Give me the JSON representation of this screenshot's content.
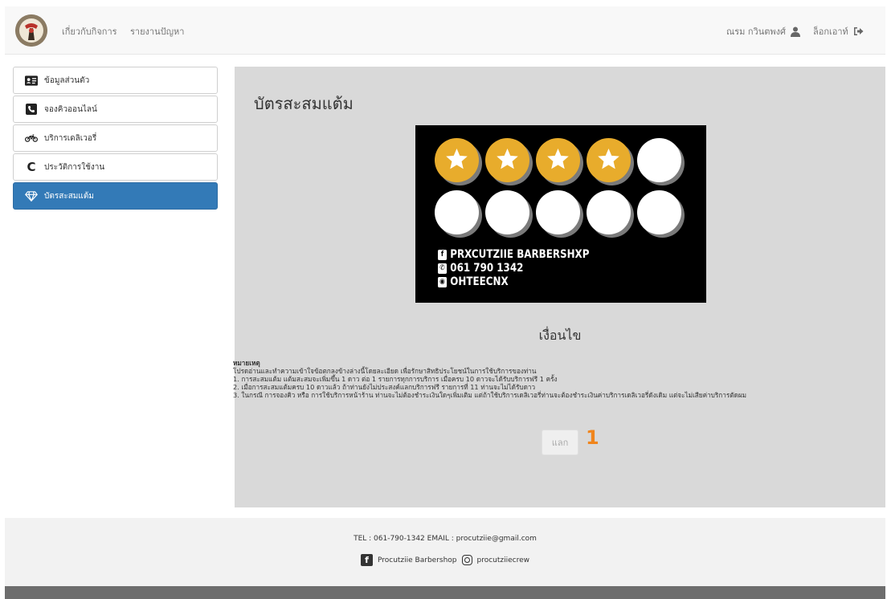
{
  "nav": {
    "links": [
      "เกี่ยวกับกิจการ",
      "รายงานปัญหา"
    ],
    "user_name": "ณรม กวินตพงศ์",
    "logout": "ล็อกเอาท์"
  },
  "sidebar": {
    "items": [
      {
        "label": "ข้อมูลส่วนตัว",
        "icon": "id-card-icon"
      },
      {
        "label": "จองคิวออนไลน์",
        "icon": "phone-icon"
      },
      {
        "label": "บริการเดลิเวอรี่",
        "icon": "motorcycle-icon"
      },
      {
        "label": "ประวัติการใช้งาน",
        "icon": "history-icon"
      },
      {
        "label": "บัตรสะสมแต้ม",
        "icon": "diamond-icon",
        "active": true
      }
    ]
  },
  "main": {
    "title": "บัตรสะสมแต้ม",
    "card": {
      "stars_earned": 4,
      "stars_total": 10,
      "facebook": "PRXCUTZIIE BARBERSHXP",
      "phone": "061 790 1342",
      "line": "OHTEECNX",
      "gold_color": "#e8ac2c"
    },
    "conditions_title": "เงื่อนไข",
    "notes": {
      "heading": "หมายเหตุ",
      "intro": "โปรดอ่านและทำความเข้าใจข้อตกลงข้างล่างนี้โดยละเอียด เพื่อรักษาสิทธิประโยชน์ในการใช้บริการของท่าน",
      "items": [
        "1. การสะสมแต้ม แต้มสะสมจะเพิ่มขึ้น 1 ดาว ต่อ 1 รายการทุกการบริการ เมื่อครบ 10 ดาวจะได้รับบริการฟรี 1 ครั้ง",
        "2. เมื่อการสะสมแต้มครบ 10 ดาวแล้ว ถ้าท่านยังไม่ประสงค์แลกบริการฟรี รายการที่ 11 ท่านจะไม่ได้รับดาว",
        "3. ในกรณี การจองคิว หรือ การใช้บริการหน้าร้าน ท่านจะไม่ต้องชำระเงินใดๆเพิ่มเติม แต่ถ้าใช้บริการเดลิเวอรี่ท่านจะต้องชำระเงินค่าบริการเดลิเวอรี่ดังเดิม แต่จะไม่เสียค่าบริการตัดผม"
      ]
    },
    "redeem_label": "แลก",
    "redeem_count": "1"
  },
  "footer": {
    "contact": "TEL : 061-790-1342 EMAIL : procutziie@gmail.com",
    "facebook": "Procutziie Barbershop",
    "instagram": "procutziiecrew"
  }
}
